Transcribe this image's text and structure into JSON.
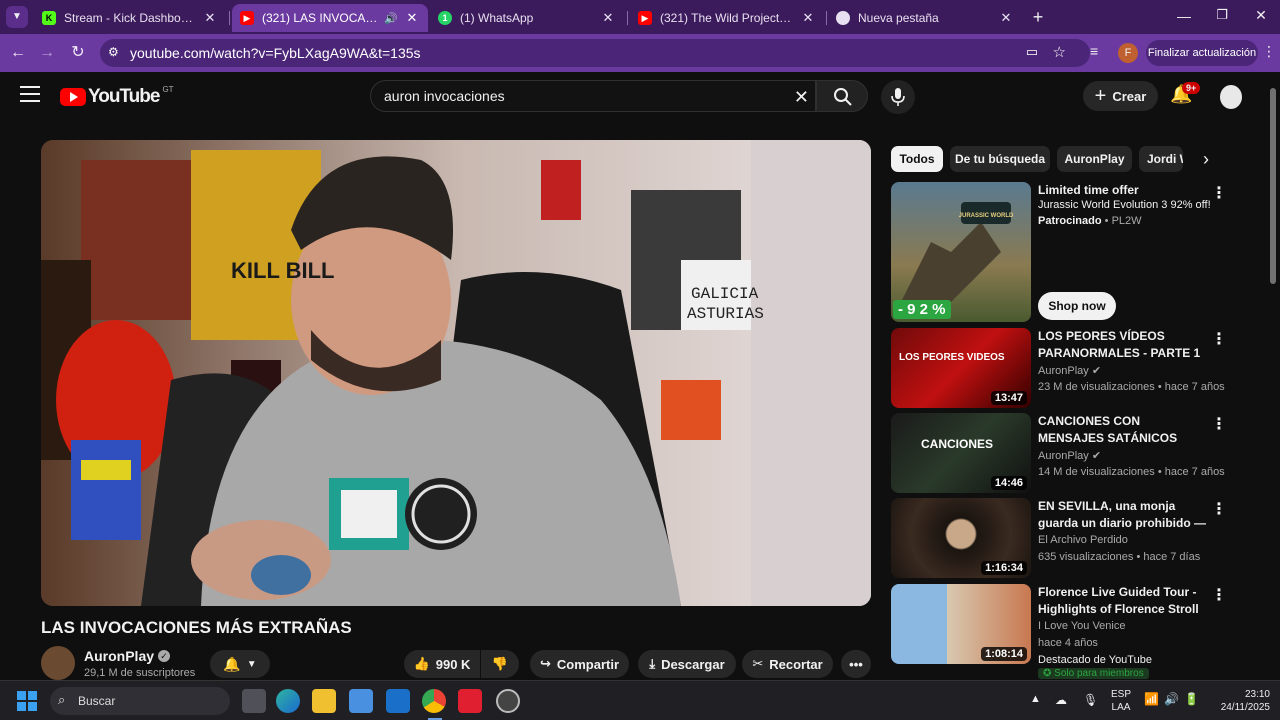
{
  "tabs": [
    {
      "title": "Stream - Kick Dashboard",
      "favicon": "kick-icon",
      "active": false
    },
    {
      "title": "(321) LAS INVOCACIONES",
      "favicon": "youtube-icon",
      "active": true
    },
    {
      "title": "(1) WhatsApp",
      "favicon": "whatsapp-icon",
      "active": false
    },
    {
      "title": "(321) The Wild Project #349 - T",
      "favicon": "youtube-icon",
      "active": false
    },
    {
      "title": "Nueva pestaña",
      "favicon": "chrome-icon",
      "active": false
    }
  ],
  "address": {
    "url": "youtube.com/watch?v=FybLXagA9WA&t=135s",
    "profile_initial": "F",
    "update_label": "Finalizar actualización"
  },
  "masthead": {
    "logo_text": "YouTube",
    "region": "GT",
    "search_value": "auron invocaciones",
    "create_label": "Crear",
    "notif_badge": "9+"
  },
  "video": {
    "title": "LAS INVOCACIONES MÁS EXTRAÑAS",
    "channel": "AuronPlay",
    "subscribers": "29,1 M de suscriptores",
    "likes": "990 K",
    "share_label": "Compartir",
    "download_label": "Descargar",
    "clip_label": "Recortar",
    "overlay_text": {
      "poster": "KILL BILL",
      "sign_line1": "GALICIA",
      "sign_line2": "ASTURIAS"
    }
  },
  "chips": [
    "Todos",
    "De tu búsqueda",
    "AuronPlay",
    "Jordi W"
  ],
  "ad": {
    "title": "Limited time offer",
    "subtitle": "Jurassic World Evolution 3 92% off!",
    "sponsored": "Patrocinado",
    "advertiser": "PL2W",
    "discount": "- 9 2 %",
    "cta": "Shop now",
    "thumb_text": "JURASSIC WORLD"
  },
  "recommendations": [
    {
      "title": "LOS PEORES VÍDEOS PARANORMALES - PARTE 1",
      "channel": "AuronPlay",
      "verified": true,
      "meta": "23 M de visualizaciones • hace 7 años",
      "duration": "13:47",
      "thumb_text": "LOS PEORES VIDEOS"
    },
    {
      "title": "CANCIONES CON MENSAJES SATÁNICOS",
      "channel": "AuronPlay",
      "verified": true,
      "meta": "14 M de visualizaciones • hace 7 años",
      "duration": "14:46",
      "thumb_text": "CANCIONES"
    },
    {
      "title": "EN SEVILLA, una monja guarda un diario prohibido — 30 años ...",
      "channel": "El Archivo Perdido",
      "verified": false,
      "meta": "635 visualizaciones • hace 7 días",
      "duration": "1:16:34",
      "thumb_text": ""
    },
    {
      "title": "Florence Live Guided Tour - Highlights of Florence Stroll b...",
      "channel": "I Love You Venice",
      "verified": false,
      "meta": "hace 4 años",
      "meta2": "Destacado de YouTube",
      "badge": "Solo para miembros",
      "duration": "1:08:14",
      "thumb_text": ""
    }
  ],
  "taskbar": {
    "search_placeholder": "Buscar",
    "lang_line1": "ESP",
    "lang_line2": "LAA",
    "time": "23:10",
    "date": "24/11/2025"
  },
  "colors": {
    "tab_strip": "#3b1b5c",
    "toolbar": "#6a3aa0",
    "youtube_red": "#ff0000",
    "background": "#0f0f0f",
    "ad_green": "#2ba640"
  }
}
